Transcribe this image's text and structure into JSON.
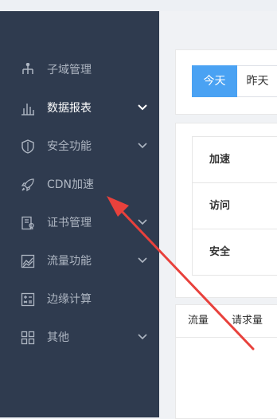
{
  "sidebar": {
    "items": [
      {
        "label": "子域管理",
        "icon": "sitemap-icon",
        "has_chevron": false
      },
      {
        "label": "数据报表",
        "icon": "bar-chart-icon",
        "has_chevron": true
      },
      {
        "label": "安全功能",
        "icon": "shield-icon",
        "has_chevron": true
      },
      {
        "label": "CDN加速",
        "icon": "rocket-icon",
        "has_chevron": false
      },
      {
        "label": "证书管理",
        "icon": "certificate-icon",
        "has_chevron": true
      },
      {
        "label": "流量功能",
        "icon": "traffic-chart-icon",
        "has_chevron": true
      },
      {
        "label": "边缘计算",
        "icon": "calculator-icon",
        "has_chevron": false
      },
      {
        "label": "其他",
        "icon": "grid-icon",
        "has_chevron": true
      }
    ]
  },
  "date_range": {
    "today": "今天",
    "yesterday": "昨天"
  },
  "summary_table": {
    "rows": [
      "加速",
      "访问",
      "安全"
    ]
  },
  "tabs": {
    "items": [
      "流量",
      "请求量"
    ]
  },
  "colors": {
    "sidebar_bg": "#2f3b4f",
    "accent": "#4aa2f3",
    "annotation_arrow": "#e8413c"
  }
}
